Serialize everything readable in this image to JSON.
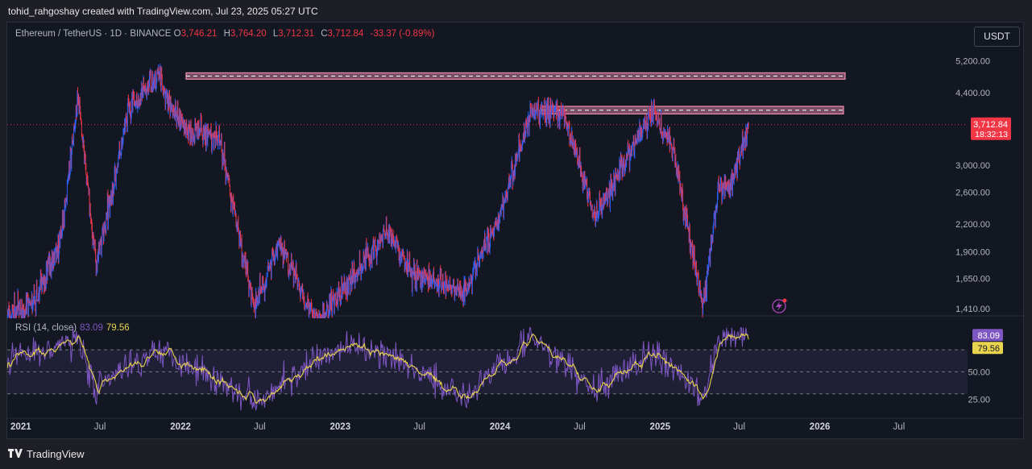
{
  "header": {
    "attribution": "tohid_rahgoshay created with TradingView.com, Jul 23, 2025 05:27 UTC"
  },
  "legend": {
    "symbol": "Ethereum / TetherUS · 1D · BINANCE",
    "open_label": "O",
    "open": "3,746.21",
    "high_label": "H",
    "high": "3,764.20",
    "low_label": "L",
    "low": "3,712.31",
    "close_label": "C",
    "close": "3,712.84",
    "change": "-33.37 (-0.89%)"
  },
  "currency_button": "USDT",
  "price_axis": {
    "ticks": [
      "5,200.00",
      "4,400.00",
      "3,000.00",
      "2,600.00",
      "2,200.00",
      "1,900.00",
      "1,650.00",
      "1,410.00"
    ],
    "last_price": "3,712.84",
    "countdown": "18:32:13"
  },
  "rsi": {
    "label": "RSI (14, close)",
    "value": "83.09",
    "ma_value": "79.56",
    "ticks": [
      "50.00",
      "25.00"
    ]
  },
  "time_axis": {
    "labels": [
      "2021",
      "Jul",
      "2022",
      "Jul",
      "2023",
      "Jul",
      "2024",
      "Jul",
      "2025",
      "Jul",
      "2026",
      "Jul"
    ]
  },
  "footer": {
    "brand": "TradingView"
  },
  "colors": {
    "up": "#2962ff",
    "down": "#f23645",
    "rsi": "#7e57c2",
    "rsi_ma": "#e8d44d",
    "zone": "#f48fb1"
  },
  "chart_data": {
    "type": "line",
    "title": "Ethereum / TetherUS · 1D · BINANCE",
    "scale": "log",
    "ylim": [
      1350,
      5600
    ],
    "series": [
      {
        "kind": "price",
        "x": [
          "2020-12-01",
          "2021-02-01",
          "2021-04-01",
          "2021-05-12",
          "2021-06-22",
          "2021-09-03",
          "2021-11-10",
          "2022-01-01",
          "2022-04-01",
          "2022-06-18",
          "2022-08-14",
          "2022-11-09",
          "2023-04-16",
          "2023-06-15",
          "2023-10-12",
          "2024-01-01",
          "2024-03-12",
          "2024-05-27",
          "2024-08-05",
          "2024-12-16",
          "2025-02-01",
          "2025-04-09",
          "2025-05-13",
          "2025-06-10",
          "2025-07-22"
        ],
        "values": [
          1350,
          1450,
          2000,
          4300,
          1750,
          3950,
          4850,
          3700,
          3450,
          1400,
          2000,
          1300,
          2100,
          1700,
          1550,
          2300,
          4000,
          3900,
          2300,
          4000,
          3200,
          1420,
          2600,
          2700,
          3712.84
        ]
      },
      {
        "kind": "rsi",
        "x": [
          "2020-12-01",
          "2021-05-12",
          "2021-06-22",
          "2021-11-10",
          "2022-06-18",
          "2023-01-15",
          "2023-04-16",
          "2023-10-12",
          "2024-03-12",
          "2024-08-05",
          "2024-12-16",
          "2025-04-09",
          "2025-05-13",
          "2025-07-22"
        ],
        "values": [
          60,
          80,
          35,
          72,
          25,
          74,
          65,
          28,
          82,
          33,
          68,
          28,
          78,
          83.09
        ]
      }
    ],
    "resistance_zones": [
      {
        "low": 4720,
        "high": 4880
      },
      {
        "low": 3930,
        "high": 4090
      }
    ],
    "rsi_bands": [
      70,
      50,
      30
    ]
  }
}
